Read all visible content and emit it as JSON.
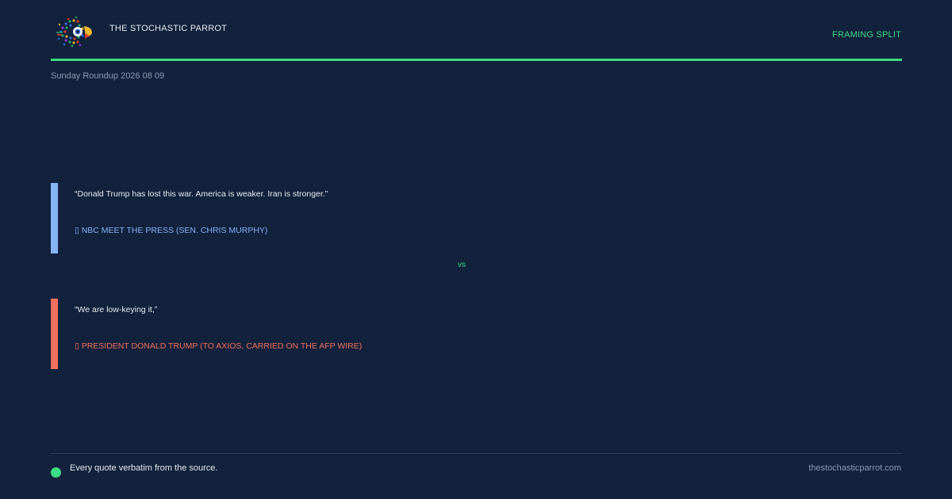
{
  "header": {
    "brand": "THE STOCHASTIC PARROT",
    "tag": "FRAMING SPLIT",
    "date": "Sunday Roundup 2026 08 09",
    "logo_icon": "parrot-logo-icon"
  },
  "quotes": [
    {
      "text": "“Donald Trump has lost this war. America is weaker. Iran is stronger.”",
      "attribution": "▯ NBC MEET THE PRESS (SEN. CHRIS MURPHY)",
      "color": "#86b3f5"
    },
    {
      "text": "“We are low-keying it,”",
      "attribution": "▯ PRESIDENT DONALD TRUMP (TO AXIOS, CARRIED ON THE AFP WIRE)",
      "color": "#f1705d"
    }
  ],
  "vs_label": "vs",
  "footer": {
    "note": "Every quote verbatim from the source.",
    "site": "thestochasticparrot.com"
  },
  "colors": {
    "background": "#12213c",
    "accent": "#3ddc84",
    "quote1": "#86b3f5",
    "quote2": "#f1705d"
  }
}
